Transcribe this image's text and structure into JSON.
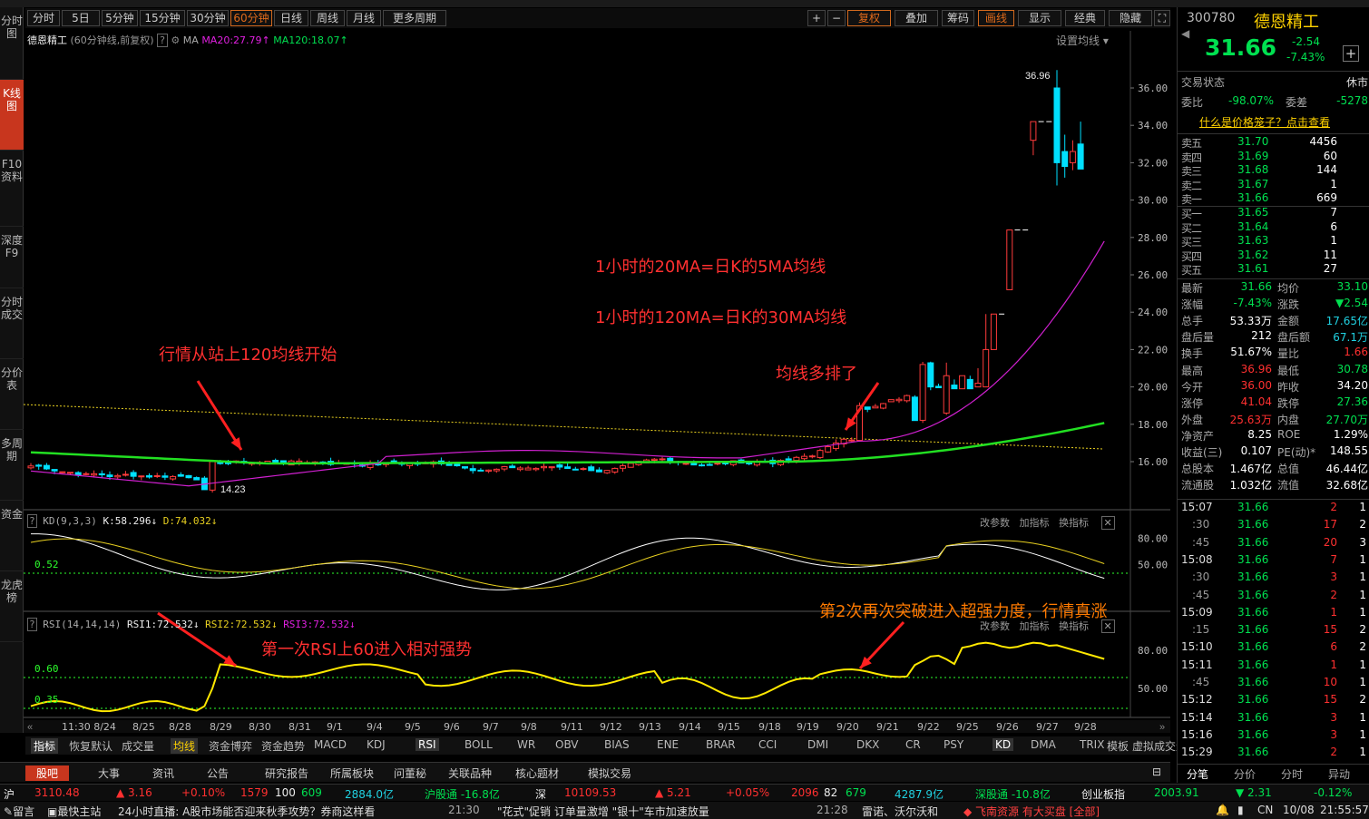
{
  "left_nav": [
    "分时图",
    "K线图",
    "F10资料",
    "深度F9",
    "分时成交",
    "分价表",
    "多周期",
    "资金",
    "龙虎榜"
  ],
  "toolbar": {
    "periods": [
      "分时",
      "5日",
      "5分钟",
      "15分钟",
      "30分钟",
      "60分钟",
      "日线",
      "周线",
      "月线",
      "更多周期"
    ],
    "selected": "60分钟",
    "right": [
      "复权",
      "叠加",
      "筹码",
      "画线",
      "显示",
      "经典",
      "隐藏"
    ],
    "settings": "设置均线"
  },
  "chart_info": {
    "name": "德恩精工",
    "mode": "(60分钟线,前复权)",
    "ma": "MA",
    "ma20": "MA20:27.79",
    "ma120": "MA120:18.07"
  },
  "kd_header": {
    "label": "KD(9,3,3)",
    "k": "K:58.296",
    "d": "D:74.032",
    "buttons": [
      "改参数",
      "加指标",
      "换指标"
    ],
    "level": "0.52"
  },
  "rsi_header": {
    "label": "RSI(14,14,14)",
    "r1": "RSI1:72.532",
    "r2": "RSI2:72.532",
    "r3": "RSI3:72.532",
    "buttons": [
      "改参数",
      "加指标",
      "换指标"
    ],
    "level1": "0.60",
    "level2": "0.35"
  },
  "annotations": {
    "a1": "1小时的20MA=日K的5MA均线",
    "a2": "1小时的120MA=日K的30MA均线",
    "a3": "行情从站上120均线开始",
    "a4": "均线多排了",
    "a5": "第一次RSI上60进入相对强势",
    "a6": "第2次再次突破进入超强力度，行情真涨"
  },
  "price_labels": {
    "high": "36.96",
    "low": "14.23"
  },
  "price_axis": [
    "36.00",
    "34.00",
    "32.00",
    "30.00",
    "28.00",
    "26.00",
    "24.00",
    "22.00",
    "20.00",
    "18.00",
    "16.00"
  ],
  "kd_axis": [
    "80.00",
    "50.00"
  ],
  "rsi_axis": [
    "80.00",
    "50.00"
  ],
  "date_axis": [
    "11:30 8/24",
    "8/25",
    "8/28",
    "8/29",
    "8/30",
    "8/31",
    "9/1",
    "9/4",
    "9/5",
    "9/6",
    "9/7",
    "9/8",
    "9/11",
    "9/12",
    "9/13",
    "9/14",
    "9/15",
    "9/18",
    "9/19",
    "9/20",
    "9/21",
    "9/22",
    "9/25",
    "9/26",
    "9/27",
    "9/28"
  ],
  "chart_data": {
    "type": "candlestick",
    "ma20_last": 27.79,
    "ma120_last": 18.07,
    "high": 36.96,
    "low": 14.23,
    "kd": {
      "k": 58.296,
      "d": 74.032
    },
    "rsi": {
      "rsi1": 72.532
    }
  },
  "bottom_tabs": [
    "指标",
    "恢复默认",
    "成交量",
    "均线",
    "资金博弈",
    "资金趋势",
    "MACD",
    "KDJ",
    "RSI",
    "BOLL",
    "WR",
    "OBV",
    "BIAS",
    "ENE",
    "BRAR",
    "CCI",
    "DMI",
    "DKX",
    "CR",
    "PSY",
    "KD",
    "DMA",
    "TRIX",
    "虚拟成交量",
    "更多",
    "模板"
  ],
  "info_tabs": [
    "股吧",
    "大事",
    "资讯",
    "公告",
    "研究报告",
    "所属板块",
    "问董秘",
    "关联品种",
    "核心题材",
    "模拟交易"
  ],
  "status": {
    "sh_label": "沪",
    "sh": "3110.48",
    "sh_chg": "▲ 3.16",
    "sh_pct": "+0.10%",
    "sh_up": "1579",
    "sh_eq": "100",
    "sh_dn": "609",
    "sh_amt": "2884.0亿",
    "hgt": "沪股通 -16.8亿",
    "sz_label": "深",
    "sz": "10109.53",
    "sz_chg": "▲ 5.21",
    "sz_pct": "+0.05%",
    "sz_up": "2096",
    "sz_eq": "82",
    "sz_dn": "679",
    "sz_amt": "4287.9亿",
    "sgt": "深股通 -10.8亿",
    "cyb_label": "创业板指",
    "cyb": "2003.91",
    "cyb_chg": "▼ 2.31",
    "cyb_pct": "-0.12%"
  },
  "news": {
    "n1": "留言",
    "n2": "最快主站",
    "n3": "24小时直播: A股市场能否迎来秋季攻势？券商这样看",
    "t1": "21:30",
    "n4": "\"花式\"促销 订单量激增 \"银十\"车市加速放量",
    "t2": "21:28",
    "n5": "雷诺、沃尔沃和",
    "n6": "飞南资源 有大买盘 [全部]",
    "cn": "CN",
    "date": "10/08",
    "time": "21:55:57"
  },
  "quote": {
    "code": "300780",
    "name": "德恩精工",
    "price": "31.66",
    "chg": "-2.54",
    "pct": "-7.43%",
    "state_label": "交易状态",
    "state": "休市",
    "wb_label": "委比",
    "wb": "-98.07%",
    "wc_label": "委差",
    "wc": "-5278",
    "cage": "什么是价格笼子？点击查看",
    "asks": [
      [
        "卖五",
        "31.70",
        "4456"
      ],
      [
        "卖四",
        "31.69",
        "60"
      ],
      [
        "卖三",
        "31.68",
        "144"
      ],
      [
        "卖二",
        "31.67",
        "1"
      ],
      [
        "卖一",
        "31.66",
        "669"
      ]
    ],
    "bids": [
      [
        "买一",
        "31.65",
        "7"
      ],
      [
        "买二",
        "31.64",
        "6"
      ],
      [
        "买三",
        "31.63",
        "1"
      ],
      [
        "买四",
        "31.62",
        "11"
      ],
      [
        "买五",
        "31.61",
        "27"
      ]
    ],
    "stats": [
      [
        "最新",
        "31.66",
        "均价",
        "33.10"
      ],
      [
        "涨幅",
        "-7.43%",
        "涨跌",
        "▼2.54"
      ],
      [
        "总手",
        "53.33万",
        "金额",
        "17.65亿"
      ],
      [
        "盘后量",
        "212",
        "盘后额",
        "67.1万"
      ],
      [
        "换手",
        "51.67%",
        "量比",
        "1.66"
      ],
      [
        "最高",
        "36.96",
        "最低",
        "30.78"
      ],
      [
        "今开",
        "36.00",
        "昨收",
        "34.20"
      ],
      [
        "涨停",
        "41.04",
        "跌停",
        "27.36"
      ],
      [
        "外盘",
        "25.63万",
        "内盘",
        "27.70万"
      ],
      [
        "净资产",
        "8.25",
        "ROE",
        "1.29%"
      ],
      [
        "收益(三)",
        "0.107",
        "PE(动)*",
        "148.55"
      ],
      [
        "总股本",
        "1.467亿",
        "总值",
        "46.44亿"
      ],
      [
        "流通股",
        "1.032亿",
        "流值",
        "32.68亿"
      ]
    ],
    "ticks": [
      [
        "15:07",
        "31.66",
        "2",
        "1"
      ],
      [
        ":30",
        "31.66",
        "17",
        "2"
      ],
      [
        ":45",
        "31.66",
        "20",
        "3"
      ],
      [
        "15:08",
        "31.66",
        "7",
        "1"
      ],
      [
        ":30",
        "31.66",
        "3",
        "1"
      ],
      [
        ":45",
        "31.66",
        "2",
        "1"
      ],
      [
        "15:09",
        "31.66",
        "1",
        "1"
      ],
      [
        ":15",
        "31.66",
        "15",
        "2"
      ],
      [
        "15:10",
        "31.66",
        "6",
        "2"
      ],
      [
        "15:11",
        "31.66",
        "1",
        "1"
      ],
      [
        ":45",
        "31.66",
        "10",
        "1"
      ],
      [
        "15:12",
        "31.66",
        "15",
        "2"
      ],
      [
        "15:14",
        "31.66",
        "3",
        "1"
      ],
      [
        "15:16",
        "31.66",
        "3",
        "1"
      ],
      [
        "15:29",
        "31.66",
        "2",
        "1"
      ]
    ],
    "tabs": [
      "分笔",
      "分价",
      "分时",
      "异动"
    ]
  }
}
